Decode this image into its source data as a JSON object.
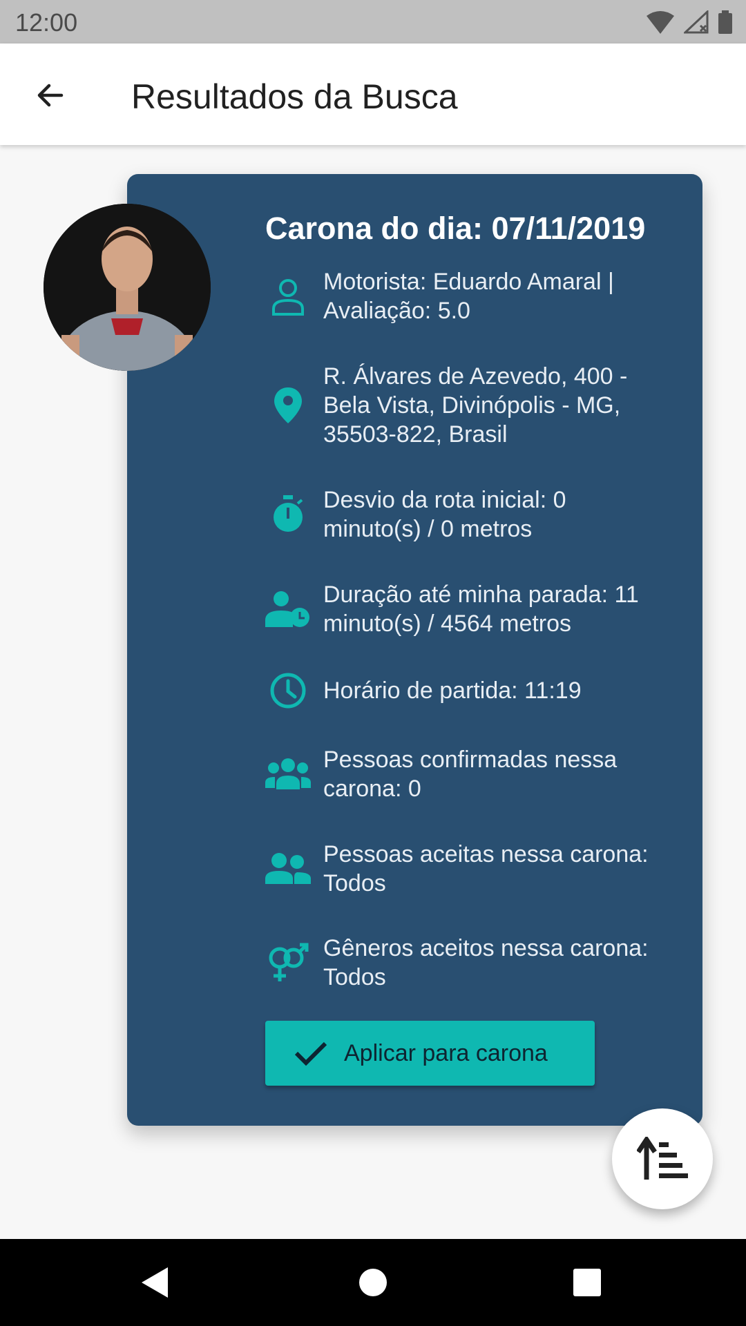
{
  "status_bar": {
    "time": "12:00"
  },
  "app_bar": {
    "title": "Resultados da Busca"
  },
  "card": {
    "title": "Carona do dia: 07/11/2019",
    "rows": [
      {
        "icon": "person-outline-icon",
        "line1": "Motorista: Eduardo Amaral |",
        "line2": "Avaliação: 5.0"
      },
      {
        "icon": "location-pin-icon",
        "line1": "R. Álvares de Azevedo, 400 -",
        "line2": "Bela Vista, Divinópolis - MG,",
        "line3": "35503-822, Brasil"
      },
      {
        "icon": "stopwatch-icon",
        "line1": "Desvio da rota inicial: 0",
        "line2": "minuto(s) / 0 metros"
      },
      {
        "icon": "person-clock-icon",
        "line1": "Duração até minha parada: 11",
        "line2": "minuto(s) / 4564 metros"
      },
      {
        "icon": "clock-icon",
        "line1": "Horário de partida: 11:19"
      },
      {
        "icon": "group-icon",
        "line1": "Pessoas confirmadas nessa",
        "line2": "carona: 0"
      },
      {
        "icon": "people-icon",
        "line1": "Pessoas aceitas nessa carona:",
        "line2": "Todos"
      },
      {
        "icon": "gender-icon",
        "line1": "Gêneros aceitos nessa carona:",
        "line2": "Todos"
      }
    ],
    "apply_label": "Aplicar para carona"
  },
  "colors": {
    "accent": "#0fb8b1",
    "card_bg": "#294f71"
  }
}
